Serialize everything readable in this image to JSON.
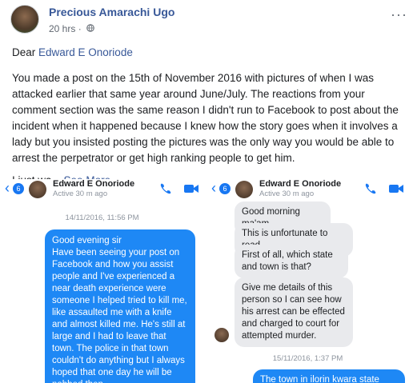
{
  "post": {
    "author": "Precious Amarachi Ugo",
    "time": "20 hrs",
    "more": "···",
    "salutation_prefix": "Dear ",
    "salutation_name": "Edward E Onoriode",
    "paragraph": "You made a post on the 15th of November 2016 with pictures of when I was attacked earlier that same year around June/July. The reactions from your comment section was the same reason I didn't run to Facebook to post about the incident when it happened because I knew how the story goes when it involves a lady but you insisted posting the pictures was the only way you would be able to arrest the perpetrator or get high ranking people to get him.",
    "truncated": "I just wa...",
    "see_more": "See More"
  },
  "left_shot": {
    "badge": "6",
    "contact": "Edward E Onoriode",
    "active": "Active 30 m ago",
    "timestamp": "14/11/2016, 11:56 PM",
    "message": "Good evening sir\nHave been seeing your post on Facebook and how you assist people and I've experienced a near death experience were someone I helped tried to kill me, like assaulted me with a knife and almost killed me. He's still at large and I had to leave that town. The police in that town couldn't do anything but I always hoped that one day he will be nabbed then"
  },
  "right_shot": {
    "badge": "6",
    "contact": "Edward E Onoriode",
    "active": "Active 30 m ago",
    "messages": [
      "Good morning ma'am",
      "This is unfortunate to read",
      "First of all, which state and town is that?",
      "Give me details of this person so I can see how his arrest can be effected and charged to court for attempted murder."
    ],
    "timestamp": "15/11/2016, 1:37 PM",
    "reply": "The town in ilorin kwara state"
  },
  "colors": {
    "link": "#385898",
    "messenger_blue": "#1e88f5",
    "bubble_gray": "#e9eaed"
  },
  "icons": [
    "globe-icon",
    "more-icon",
    "back-chevron-icon",
    "phone-icon",
    "video-camera-icon"
  ]
}
